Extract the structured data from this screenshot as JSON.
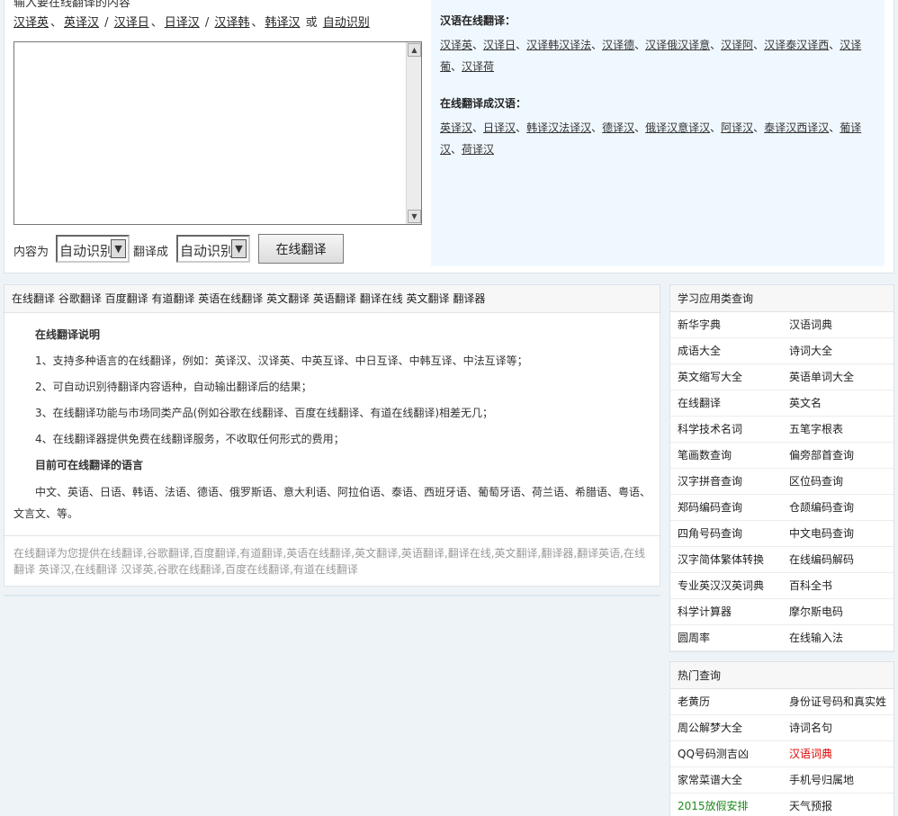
{
  "translator": {
    "input_label": "输入要在线翻译的内容",
    "quick_links": [
      {
        "label": "汉译英"
      },
      {
        "sep": "、"
      },
      {
        "label": "英译汉"
      },
      {
        "sep": " / "
      },
      {
        "label": "汉译日"
      },
      {
        "sep": "、"
      },
      {
        "label": "日译汉"
      },
      {
        "sep": " / "
      },
      {
        "label": "汉译韩"
      },
      {
        "sep": "、"
      },
      {
        "label": "韩译汉"
      },
      {
        "sep": " 或 "
      },
      {
        "label": "自动识别"
      }
    ],
    "input_value": "",
    "content_label": "内容为",
    "from_value": "自动识别",
    "to_label": "翻译成",
    "to_value": "自动识别",
    "submit_label": "在线翻译"
  },
  "info": {
    "zh_to_title": "汉语在线翻译：",
    "zh_to_links": [
      "汉译英",
      "汉译日",
      "汉译韩汉译法",
      "汉译德",
      "汉译俄汉译意",
      "汉译阿",
      "汉译泰汉译西",
      "汉译葡",
      "汉译荷"
    ],
    "to_zh_title": "在线翻译成汉语：",
    "to_zh_links": [
      "英译汉",
      "日译汉",
      "韩译汉法译汉",
      "德译汉",
      "俄译汉意译汉",
      "阿译汉",
      "泰译汉西译汉",
      "葡译汉",
      "荷译汉"
    ],
    "separator": "、"
  },
  "main": {
    "header": "在线翻译 谷歌翻译 百度翻译 有道翻译 英语在线翻译 英文翻译 英语翻译 翻译在线 英文翻译 翻译器",
    "section1_title": "在线翻译说明",
    "points": [
      "1、支持多种语言的在线翻译，例如：英译汉、汉译英、中英互译、中日互译、中韩互译、中法互译等；",
      "2、可自动识别待翻译内容语种，自动输出翻译后的结果；",
      "3、在线翻译功能与市场同类产品(例如谷歌在线翻译、百度在线翻译、有道在线翻译)相差无几；",
      "4、在线翻译器提供免费在线翻译服务，不收取任何形式的费用；"
    ],
    "section2_title": "目前可在线翻译的语言",
    "languages": "中文、英语、日语、韩语、法语、德语、俄罗斯语、意大利语、阿拉伯语、泰语、西班牙语、葡萄牙语、荷兰语、希腊语、粤语、文言文、等。",
    "footer": "在线翻译为您提供在线翻译,谷歌翻译,百度翻译,有道翻译,英语在线翻译,英文翻译,英语翻译,翻译在线,英文翻译,翻译器,翻译英语,在线翻译 英译汉,在线翻译 汉译英,谷歌在线翻译,百度在线翻译,有道在线翻译"
  },
  "sidebar": {
    "study_title": "学习应用类查询",
    "study_rows": [
      [
        "新华字典",
        "汉语词典"
      ],
      [
        "成语大全",
        "诗词大全"
      ],
      [
        "英文缩写大全",
        "英语单词大全"
      ],
      [
        "在线翻译",
        "英文名"
      ],
      [
        "科学技术名词",
        "五笔字根表"
      ],
      [
        "笔画数查询",
        "偏旁部首查询"
      ],
      [
        "汉字拼音查询",
        "区位码查询"
      ],
      [
        "郑码编码查询",
        "仓颉编码查询"
      ],
      [
        "四角号码查询",
        "中文电码查询"
      ],
      [
        "汉字简体繁体转换",
        "在线编码解码"
      ],
      [
        "专业英汉汉英词典",
        "百科全书"
      ],
      [
        "科学计算器",
        "摩尔斯电码"
      ],
      [
        "圆周率",
        "在线输入法"
      ]
    ],
    "hot_title": "热门查询",
    "hot_rows": [
      [
        "老黄历",
        "身份证号码和真实姓"
      ],
      [
        "周公解梦大全",
        "诗词名句"
      ],
      [
        "QQ号码测吉凶",
        "汉语词典"
      ],
      [
        "家常菜谱大全",
        "手机号归属地"
      ],
      [
        "2015放假安排",
        "天气预报"
      ]
    ],
    "colors": {
      "highlight_red": "#e00000",
      "highlight_green": "#1c8a1c"
    }
  }
}
